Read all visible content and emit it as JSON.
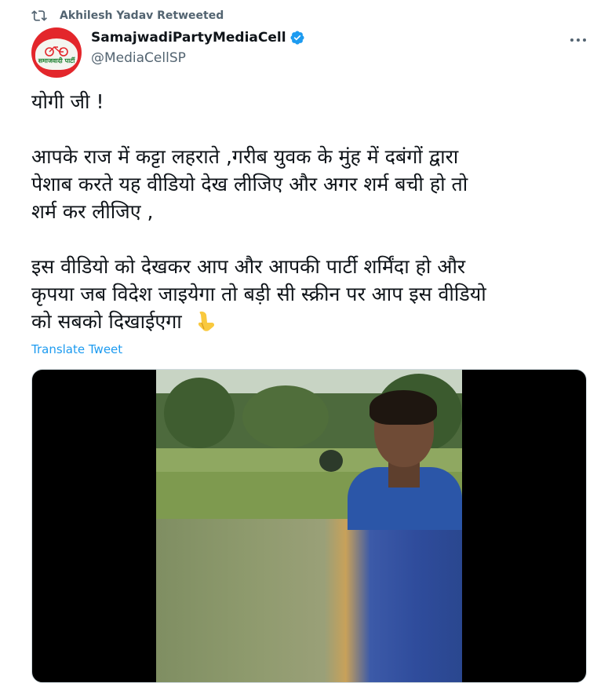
{
  "retweet": {
    "text": "Akhilesh Yadav Retweeted",
    "icon": "retweet-icon"
  },
  "author": {
    "display_name": "SamajwadiPartyMediaCell",
    "handle": "@MediaCellSP",
    "verified": true,
    "avatar_text": "समाजवादी पार्टी"
  },
  "tweet": {
    "lines": [
      "योगी जी !",
      "आपके राज में कट्टा लहराते ,गरीब युवक के मुंह में दबंगों द्वारा",
      "पेशाब करते यह वीडियो देख लीजिए और अगर शर्म बची हो तो",
      "शर्म कर लीजिए ,",
      "इस वीडियो को देखकर आप और आपकी पार्टी शर्मिंदा हो और",
      "कृपया जब विदेश जाइयेगा तो बड़ी सी स्क्रीन पर आप इस वीडियो",
      "को सबको दिखाईएगा"
    ],
    "emoji": "point-down-icon",
    "translate_label": "Translate Tweet"
  },
  "colors": {
    "link": "#1d9bf0",
    "secondary_text": "#536471",
    "verified": "#1d9bf0",
    "brand_red": "#e3262b"
  }
}
